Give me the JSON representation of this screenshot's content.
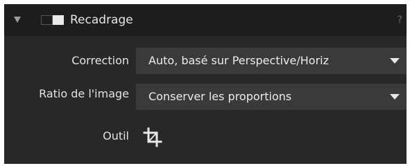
{
  "panel": {
    "title": "Recadrage",
    "help": "?",
    "expanded": true,
    "enabled": true,
    "icons": {
      "collapse": "triangle-down-icon",
      "toggle": "toggle-switch-icon",
      "help": "question-mark-icon",
      "tool": "crop-icon"
    }
  },
  "fields": {
    "correction": {
      "label": "Correction",
      "value": "Auto, basé sur Perspective/Horiz"
    },
    "ratio": {
      "label": "Ratio de l'image",
      "value": "Conserver les proportions"
    },
    "outil": {
      "label": "Outil"
    }
  },
  "colors": {
    "panel_background": "#282828",
    "header_background": "#1d1d1d",
    "dropdown_background": "#3a3a3a",
    "text": "#e6e6e6"
  }
}
